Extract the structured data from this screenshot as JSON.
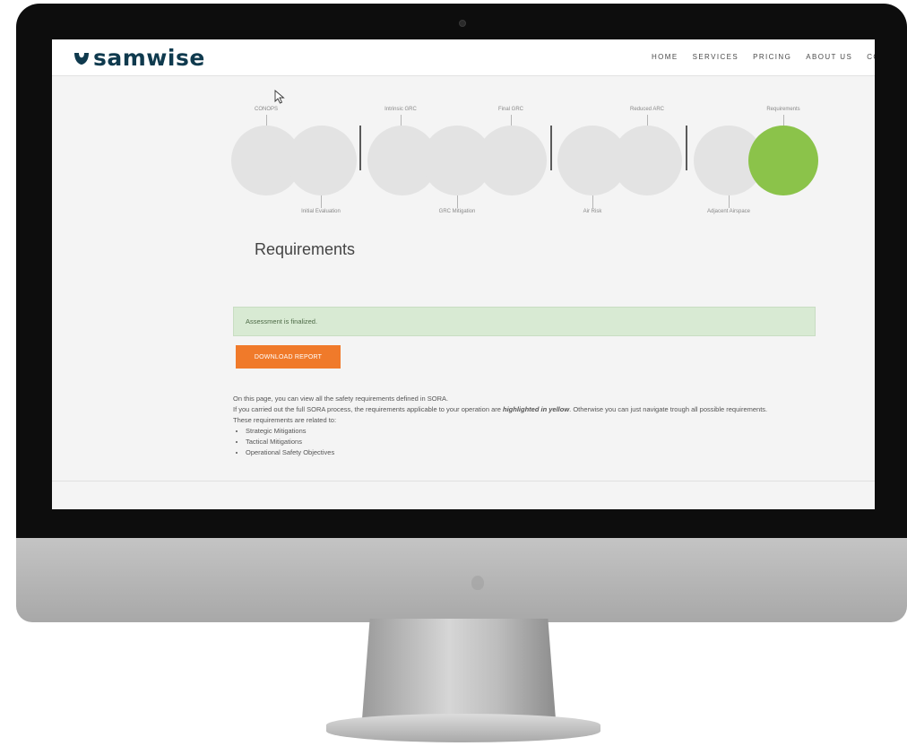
{
  "brand": {
    "name": "samwise",
    "color": "#0f3a4e"
  },
  "nav": [
    "HOME",
    "SERVICES",
    "PRICING",
    "ABOUT US",
    "CO"
  ],
  "steps": {
    "top": [
      "CONOPS",
      "Intrinsic GRC",
      "Final GRC",
      "Reduced ARC",
      "Requirements"
    ],
    "bottom": [
      "Initial Evaluation",
      "GRC Mitigation",
      "Air Risk",
      "Adjacent Airspace"
    ]
  },
  "colors": {
    "active_step": "#8bc34a",
    "button": "#f07a2a",
    "alert_bg": "#d8ead3"
  },
  "page": {
    "title": "Requirements",
    "alert": "Assessment is finalized.",
    "download_button": "DOWNLOAD REPORT",
    "desc_line1": "On this page, you can view all the safety requirements defined in SORA.",
    "desc_line2_pre": "If you carried out the full SORA process, the requirements applicable to your operation are ",
    "desc_line2_em": "highlighted in yellow",
    "desc_line2_post": ". Otherwise you can just navigate trough all possible requirements.",
    "desc_line3": "These requirements are related to:",
    "list": [
      "Strategic Mitigations",
      "Tactical Mitigations",
      "Operational Safety Objectives"
    ]
  },
  "icons": {
    "cursor": "mouse-pointer-icon",
    "logo": "samwise-logo-icon"
  }
}
